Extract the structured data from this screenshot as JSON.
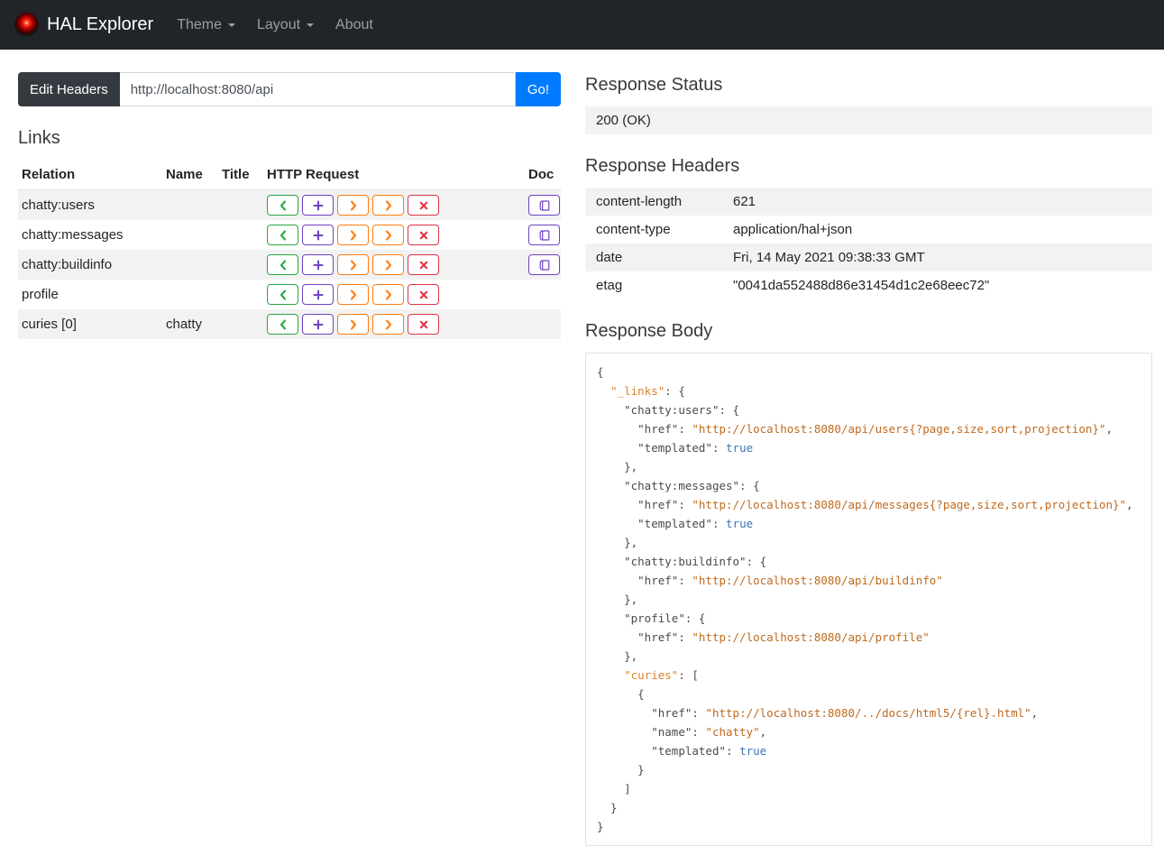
{
  "navbar": {
    "brand": "HAL Explorer",
    "items": [
      {
        "label": "Theme",
        "caret": true
      },
      {
        "label": "Layout",
        "caret": true
      },
      {
        "label": "About",
        "caret": false
      }
    ]
  },
  "toolbar": {
    "edit_headers_label": "Edit Headers",
    "url_value": "http://localhost:8080/api",
    "go_label": "Go!"
  },
  "links": {
    "title": "Links",
    "columns": [
      "Relation",
      "Name",
      "Title",
      "HTTP Request",
      "Doc"
    ],
    "rows": [
      {
        "relation": "chatty:users",
        "name": "",
        "title": "",
        "doc": true
      },
      {
        "relation": "chatty:messages",
        "name": "",
        "title": "",
        "doc": true
      },
      {
        "relation": "chatty:buildinfo",
        "name": "",
        "title": "",
        "doc": true
      },
      {
        "relation": "profile",
        "name": "",
        "title": "",
        "doc": false
      },
      {
        "relation": "curies [0]",
        "name": "chatty",
        "title": "",
        "doc": false
      }
    ],
    "request_buttons": [
      {
        "icon": "chevron-left-icon",
        "color": "#28a745"
      },
      {
        "icon": "plus-icon",
        "color": "#6f42c1"
      },
      {
        "icon": "chevron-right-icon",
        "color": "#fd7e14"
      },
      {
        "icon": "chevron-right-icon",
        "color": "#fd7e14"
      },
      {
        "icon": "x-icon",
        "color": "#dc3545"
      }
    ],
    "doc_button": {
      "icon": "book-icon",
      "color": "#6f42c1"
    }
  },
  "response": {
    "status_title": "Response Status",
    "status_value": "200 (OK)",
    "headers_title": "Response Headers",
    "headers": [
      {
        "key": "content-length",
        "value": "621"
      },
      {
        "key": "content-type",
        "value": "application/hal+json"
      },
      {
        "key": "date",
        "value": "Fri, 14 May 2021 09:38:33 GMT"
      },
      {
        "key": "etag",
        "value": "\"0041da552488d86e31454d1c2e68eec72\""
      }
    ],
    "body_title": "Response Body",
    "body_lines": [
      [
        [
          "pl",
          "{"
        ]
      ],
      [
        [
          "pl",
          "  "
        ],
        [
          "rel",
          "\"_links\""
        ],
        [
          "pl",
          ": {"
        ]
      ],
      [
        [
          "pl",
          "    "
        ],
        [
          "key",
          "\"chatty:users\""
        ],
        [
          "pl",
          ": {"
        ]
      ],
      [
        [
          "pl",
          "      "
        ],
        [
          "key",
          "\"href\""
        ],
        [
          "pl",
          ": "
        ],
        [
          "str",
          "\"http://localhost:8080/api/users{?page,size,sort,projection}\""
        ],
        [
          "pl",
          ","
        ]
      ],
      [
        [
          "pl",
          "      "
        ],
        [
          "key",
          "\"templated\""
        ],
        [
          "pl",
          ": "
        ],
        [
          "bool",
          "true"
        ]
      ],
      [
        [
          "pl",
          "    },"
        ]
      ],
      [
        [
          "pl",
          "    "
        ],
        [
          "key",
          "\"chatty:messages\""
        ],
        [
          "pl",
          ": {"
        ]
      ],
      [
        [
          "pl",
          "      "
        ],
        [
          "key",
          "\"href\""
        ],
        [
          "pl",
          ": "
        ],
        [
          "str",
          "\"http://localhost:8080/api/messages{?page,size,sort,projection}\""
        ],
        [
          "pl",
          ","
        ]
      ],
      [
        [
          "pl",
          "      "
        ],
        [
          "key",
          "\"templated\""
        ],
        [
          "pl",
          ": "
        ],
        [
          "bool",
          "true"
        ]
      ],
      [
        [
          "pl",
          "    },"
        ]
      ],
      [
        [
          "pl",
          "    "
        ],
        [
          "key",
          "\"chatty:buildinfo\""
        ],
        [
          "pl",
          ": {"
        ]
      ],
      [
        [
          "pl",
          "      "
        ],
        [
          "key",
          "\"href\""
        ],
        [
          "pl",
          ": "
        ],
        [
          "str",
          "\"http://localhost:8080/api/buildinfo\""
        ]
      ],
      [
        [
          "pl",
          "    },"
        ]
      ],
      [
        [
          "pl",
          "    "
        ],
        [
          "key",
          "\"profile\""
        ],
        [
          "pl",
          ": {"
        ]
      ],
      [
        [
          "pl",
          "      "
        ],
        [
          "key",
          "\"href\""
        ],
        [
          "pl",
          ": "
        ],
        [
          "str",
          "\"http://localhost:8080/api/profile\""
        ]
      ],
      [
        [
          "pl",
          "    },"
        ]
      ],
      [
        [
          "pl",
          "    "
        ],
        [
          "rel",
          "\"curies\""
        ],
        [
          "pl",
          ": ["
        ]
      ],
      [
        [
          "pl",
          "      {"
        ]
      ],
      [
        [
          "pl",
          "        "
        ],
        [
          "key",
          "\"href\""
        ],
        [
          "pl",
          ": "
        ],
        [
          "str",
          "\"http://localhost:8080/../docs/html5/{rel}.html\""
        ],
        [
          "pl",
          ","
        ]
      ],
      [
        [
          "pl",
          "        "
        ],
        [
          "key",
          "\"name\""
        ],
        [
          "pl",
          ": "
        ],
        [
          "str",
          "\"chatty\""
        ],
        [
          "pl",
          ","
        ]
      ],
      [
        [
          "pl",
          "        "
        ],
        [
          "key",
          "\"templated\""
        ],
        [
          "pl",
          ": "
        ],
        [
          "bool",
          "true"
        ]
      ],
      [
        [
          "pl",
          "      }"
        ]
      ],
      [
        [
          "pl",
          "    ]"
        ]
      ],
      [
        [
          "pl",
          "  }"
        ]
      ],
      [
        [
          "pl",
          "}"
        ]
      ]
    ]
  }
}
